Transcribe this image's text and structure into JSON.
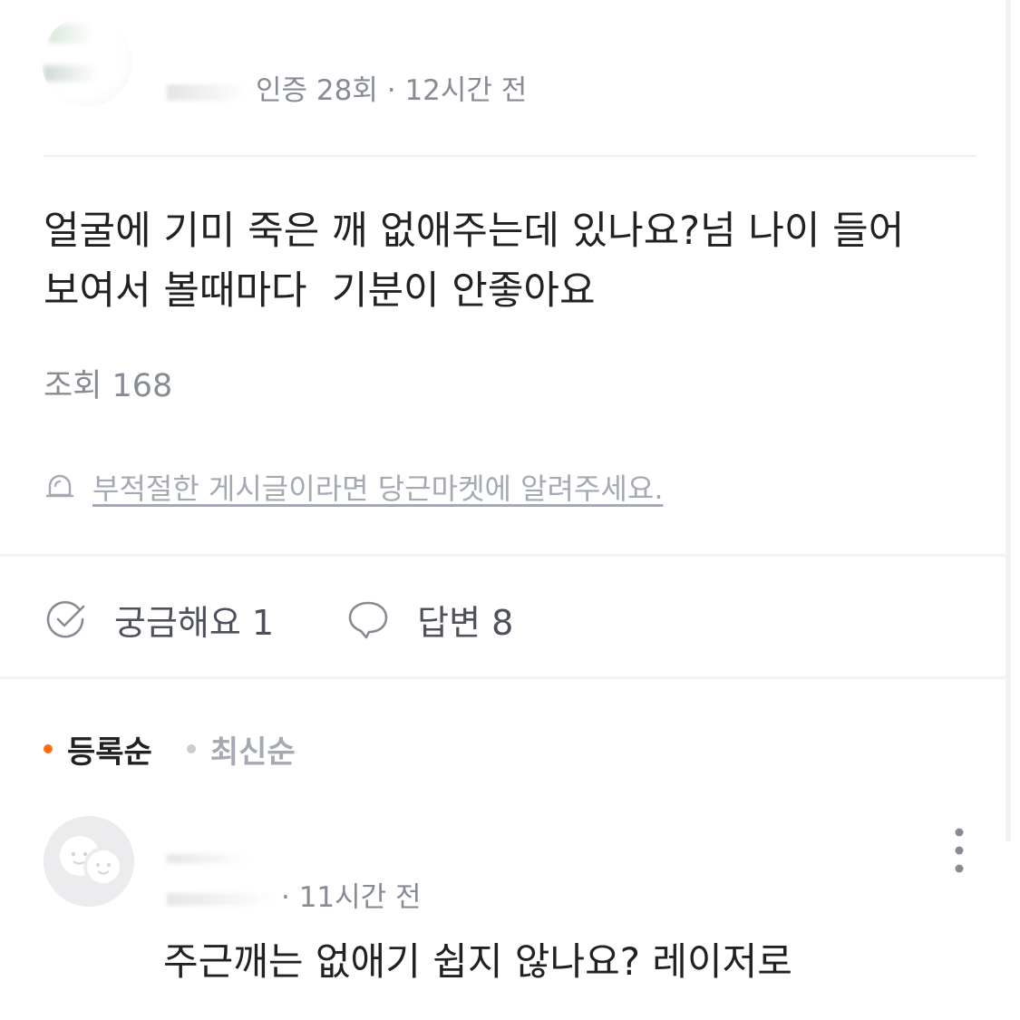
{
  "post": {
    "author_meta": {
      "verification": "인증 28회",
      "separator": "·",
      "time": "12시간 전"
    },
    "body_lines": [
      "얼굴에 기미 죽은 깨 없애주는데 있나요?넘 나이 들어",
      "보여서 볼때마다  기분이 안좋아요"
    ],
    "views": "조회 168",
    "report_text": "부적절한 게시글이라면 당근마켓에 알려주세요."
  },
  "actions": {
    "curious_label": "궁금해요 1",
    "answers_label": "답변 8",
    "curious_icon": "check-circle-icon",
    "answers_icon": "speech-bubble-icon"
  },
  "sort": {
    "active_label": "등록순",
    "inactive_label": "최신순",
    "accent_color": "#ff6f0f"
  },
  "reply": {
    "meta_time": "· 11시간 전",
    "text": "주근깨는 없애기 쉽지 않나요? 레이저로",
    "more_icon": "more-vertical-icon"
  }
}
